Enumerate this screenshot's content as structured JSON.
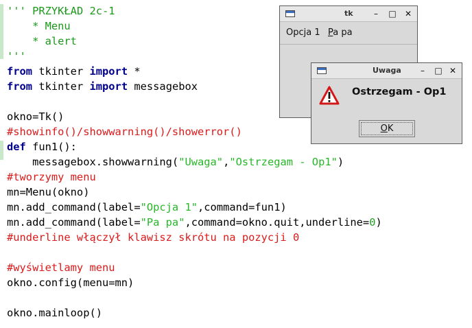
{
  "editor": {
    "docstring_open": "''' ",
    "docstring_title": "PRZYKŁAD 2c-1",
    "docstring_item1": "    * Menu",
    "docstring_item2": "    * alert",
    "docstring_close": "'''",
    "kw_from": "from",
    "kw_import": "import",
    "kw_def": "def",
    "mod_tkinter": " tkinter ",
    "import_star": " *",
    "import_messagebox": " messagebox",
    "line_okno": "okno=Tk()",
    "comment_show": "#showinfo()/showwarning()/showerror()",
    "def_rest": " fun1():",
    "mb_call_start": "    messagebox.showwarning(",
    "mb_arg1": "\"Uwaga\"",
    "mb_comma": ",",
    "mb_arg2": "\"Ostrzegam - Op1\"",
    "mb_close": ")",
    "comment_tworzymy": "#tworzymy menu",
    "line_mn": "mn=Menu(okno)",
    "add1_start": "mn.add_command(label=",
    "add1_str": "\"Opcja 1\"",
    "add1_end": ",command=fun1)",
    "add2_start": "mn.add_command(label=",
    "add2_str": "\"Pa pa\"",
    "add2_mid": ",command=okno.quit,underline=",
    "add2_num": "0",
    "add2_end": ")",
    "comment_underline": "#underline włączył klawisz skrótu na pozycji 0",
    "comment_wyswietlamy": "#wyświetlamy menu",
    "line_config": "okno.config(menu=mn)",
    "line_mainloop": "okno.mainloop()"
  },
  "tk_window": {
    "title": "tk",
    "menu": {
      "opcja1": "Opcja 1",
      "papa_first": "P",
      "papa_rest": "a pa"
    },
    "controls": {
      "minimize": "–",
      "maximize": "□",
      "close": "✕"
    }
  },
  "alert_window": {
    "title": "Uwaga",
    "message": "Ostrzegam - Op1",
    "ok_first": "O",
    "ok_rest": "K",
    "icon": "warning-triangle-icon",
    "controls": {
      "minimize": "–",
      "maximize": "□",
      "close": "✕"
    }
  },
  "colors": {
    "keyword": "#00008b",
    "string": "#27b827",
    "comment": "#dc1a1a",
    "warning_red": "#d11919"
  }
}
